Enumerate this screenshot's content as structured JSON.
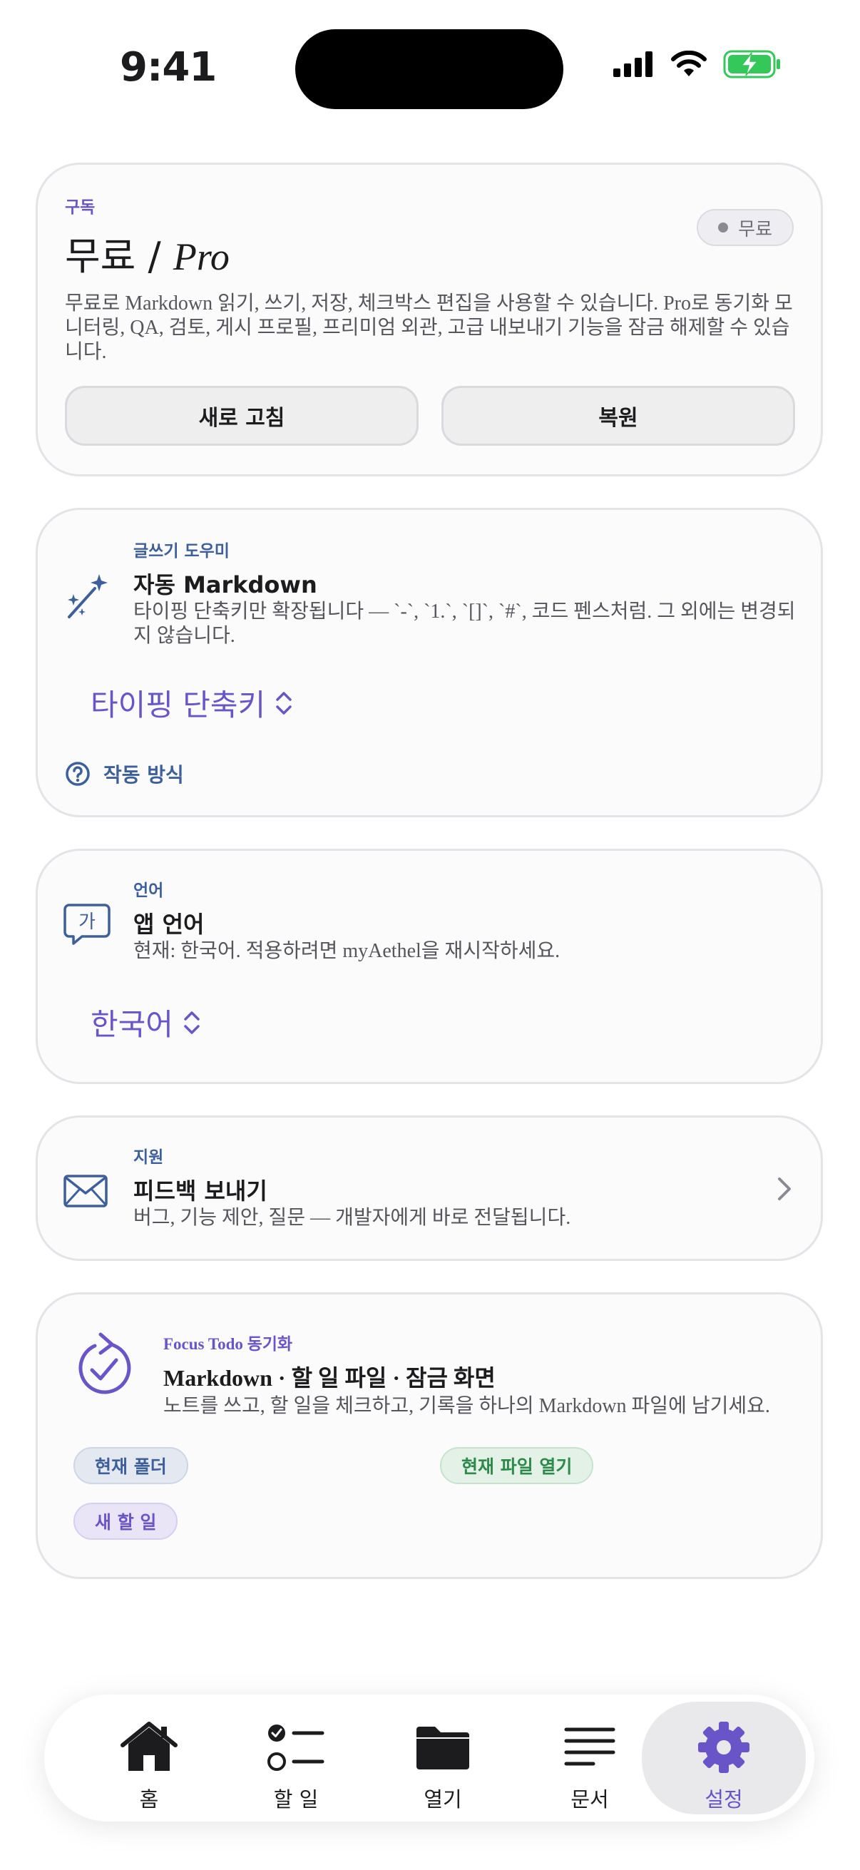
{
  "status_bar": {
    "time": "9:41"
  },
  "subscription": {
    "eyebrow": "구독",
    "title_prefix": "무료 / ",
    "title_pro": "Pro",
    "badge": "무료",
    "description": "무료로 Markdown 읽기, 쓰기, 저장, 체크박스 편집을 사용할 수 있습니다. Pro로 동기화 모니터링, QA, 검토, 게시 프로필, 프리미엄 외관, 고급 내보내기 기능을 잠금 해제할 수 있습니다.",
    "refresh_label": "새로 고침",
    "restore_label": "복원"
  },
  "writing": {
    "eyebrow": "글쓰기 도우미",
    "title": "자동 Markdown",
    "description": "타이핑 단축키만 확장됩니다 — `-`, `1.`, `[]`, `#`, 코드 펜스처럼. 그 외에는 변경되지 않습니다.",
    "picker_value": "타이핑 단축키",
    "help_link": "작동 방식"
  },
  "language": {
    "eyebrow": "언어",
    "title": "앱 언어",
    "description": "현재: 한국어. 적용하려면 myAethel을 재시작하세요.",
    "picker_value": "한국어",
    "icon_glyph": "가"
  },
  "support": {
    "eyebrow": "지원",
    "title": "피드백 보내기",
    "description": "버그, 기능 제안, 질문 — 개발자에게 바로 전달됩니다."
  },
  "focus": {
    "eyebrow": "Focus Todo 동기화",
    "title": "Markdown · 할 일 파일 · 잠금 화면",
    "description": "노트를 쓰고, 할 일을 체크하고, 기록을 하나의 Markdown 파일에 남기세요.",
    "chip_folder": "현재 폴더",
    "chip_open_file": "현재 파일 열기",
    "chip_new_todo": "새 할 일"
  },
  "tabbar": {
    "home": "홈",
    "todo": "할 일",
    "open": "열기",
    "docs": "문서",
    "settings": "설정"
  },
  "colors": {
    "accent": "#6a55c8",
    "secondary": "#3d5f9c",
    "battery": "#34c759"
  }
}
